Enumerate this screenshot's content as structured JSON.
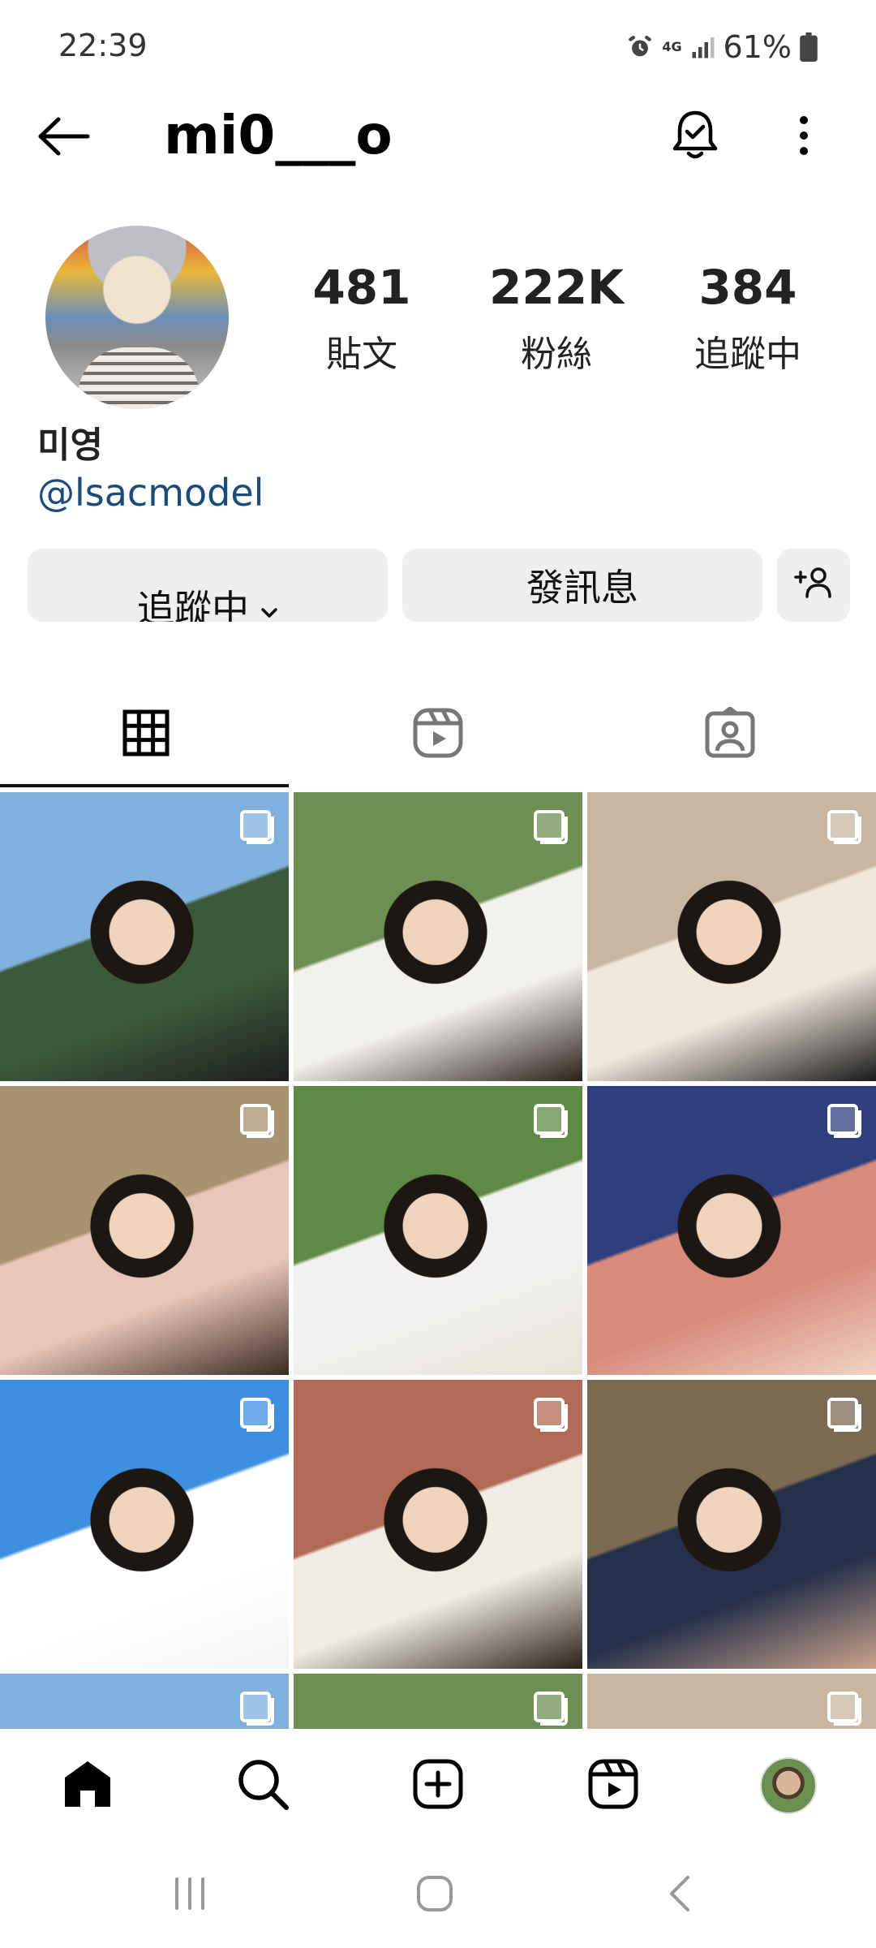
{
  "status_bar": {
    "time": "22:39",
    "network": "4G",
    "battery": "61%",
    "icons": [
      "alarm-icon",
      "network-4g-icon",
      "signal-icon",
      "battery-icon"
    ]
  },
  "header": {
    "username": "mi0___o",
    "icons": [
      "back-arrow-icon",
      "notification-bell-icon",
      "more-options-icon"
    ]
  },
  "profile": {
    "stats": [
      {
        "value": "481",
        "label": "貼文"
      },
      {
        "value": "222K",
        "label": "粉絲"
      },
      {
        "value": "384",
        "label": "追蹤中"
      }
    ],
    "display_name": "미영",
    "link": "@lsacmodel"
  },
  "actions": {
    "following": "追蹤中",
    "message": "發訊息",
    "suggest_icon": "add-person-icon"
  },
  "tabs": [
    {
      "icon": "grid-icon",
      "selected": true
    },
    {
      "icon": "reels-icon",
      "selected": false
    },
    {
      "icon": "tagged-icon",
      "selected": false
    }
  ],
  "posts": [
    {
      "type": "carousel",
      "palette": [
        "#7fb0de",
        "#3c5a3a",
        "#1e1e1e"
      ]
    },
    {
      "type": "carousel",
      "palette": [
        "#6e8f54",
        "#f3f1ec",
        "#2a1f1b"
      ]
    },
    {
      "type": "carousel",
      "palette": [
        "#c9b6a1",
        "#f1e7dc",
        "#1a1a1a"
      ]
    },
    {
      "type": "carousel",
      "palette": [
        "#a8926f",
        "#e8c6b9",
        "#3b2a22"
      ]
    },
    {
      "type": "carousel",
      "palette": [
        "#5f8a45",
        "#f1f1ef",
        "#e8e2d8"
      ]
    },
    {
      "type": "carousel",
      "palette": [
        "#2f3f7d",
        "#d88b7c",
        "#f0d3c2"
      ]
    },
    {
      "type": "carousel",
      "palette": [
        "#3f8fe0",
        "#ffffff",
        "#f4f4f4"
      ]
    },
    {
      "type": "carousel",
      "palette": [
        "#b06a55",
        "#f0ece4",
        "#2a1f1b"
      ]
    },
    {
      "type": "carousel",
      "palette": [
        "#7a6a52",
        "#26304a",
        "#c9a38c"
      ]
    }
  ],
  "bottom_nav": [
    "home-icon",
    "search-icon",
    "create-icon",
    "reels-icon",
    "profile-avatar"
  ],
  "system_nav": [
    "recent-apps-icon",
    "home-button-icon",
    "back-icon"
  ],
  "colors": {
    "accent_link": "#1b4b7a",
    "button_bg": "#efefef",
    "text": "#111111"
  }
}
